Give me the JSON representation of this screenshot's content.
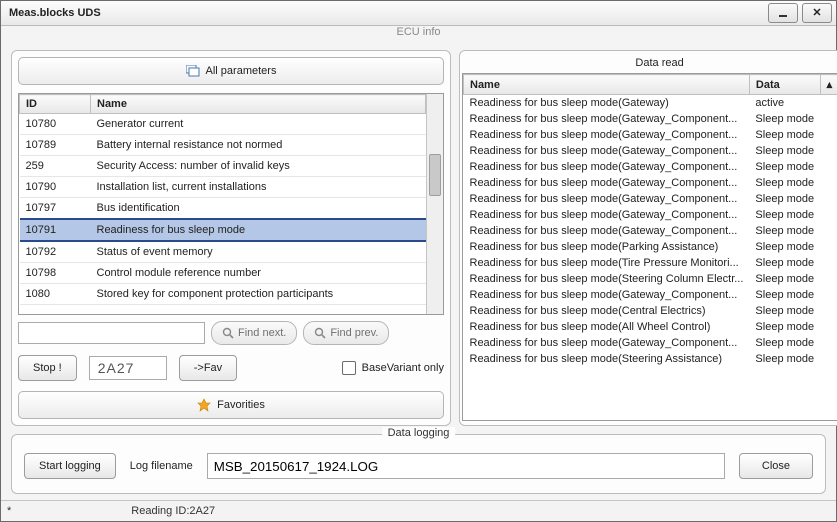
{
  "window": {
    "title": "Meas.blocks UDS",
    "subtitle": "ECU info"
  },
  "left": {
    "all_params_label": "All parameters",
    "columns": [
      "ID",
      "Name"
    ],
    "rows": [
      {
        "id": "10780",
        "name": "Generator current"
      },
      {
        "id": "10789",
        "name": "Battery internal resistance not normed"
      },
      {
        "id": "259",
        "name": "Security Access: number of invalid keys"
      },
      {
        "id": "10790",
        "name": "Installation list, current installations"
      },
      {
        "id": "10797",
        "name": "Bus identification"
      },
      {
        "id": "10791",
        "name": "Readiness for bus sleep mode",
        "selected": true
      },
      {
        "id": "10792",
        "name": "Status of event memory"
      },
      {
        "id": "10798",
        "name": "Control module reference number"
      },
      {
        "id": "1080",
        "name": "Stored key for component protection participants"
      }
    ],
    "find_next": "Find next.",
    "find_prev": "Find prev.",
    "stop": "Stop !",
    "code": "2A27",
    "to_fav": "->Fav",
    "basevariant": "BaseVariant only",
    "favorites": "Favorities"
  },
  "right": {
    "title": "Data read",
    "columns": [
      "Name",
      "Data"
    ],
    "rows": [
      {
        "name": "Readiness for bus sleep mode(Gateway)",
        "data": "active"
      },
      {
        "name": "Readiness for bus sleep mode(Gateway_Component...",
        "data": "Sleep mode"
      },
      {
        "name": "Readiness for bus sleep mode(Gateway_Component...",
        "data": "Sleep mode"
      },
      {
        "name": "Readiness for bus sleep mode(Gateway_Component...",
        "data": "Sleep mode"
      },
      {
        "name": "Readiness for bus sleep mode(Gateway_Component...",
        "data": "Sleep mode"
      },
      {
        "name": "Readiness for bus sleep mode(Gateway_Component...",
        "data": "Sleep mode"
      },
      {
        "name": "Readiness for bus sleep mode(Gateway_Component...",
        "data": "Sleep mode"
      },
      {
        "name": "Readiness for bus sleep mode(Gateway_Component...",
        "data": "Sleep mode"
      },
      {
        "name": "Readiness for bus sleep mode(Gateway_Component...",
        "data": "Sleep mode"
      },
      {
        "name": "Readiness for bus sleep mode(Parking Assistance)",
        "data": "Sleep mode"
      },
      {
        "name": "Readiness for bus sleep mode(Tire Pressure Monitori...",
        "data": "Sleep mode"
      },
      {
        "name": "Readiness for bus sleep mode(Steering Column Electr...",
        "data": "Sleep mode"
      },
      {
        "name": "Readiness for bus sleep mode(Gateway_Component...",
        "data": "Sleep mode"
      },
      {
        "name": "Readiness for bus sleep mode(Central Electrics)",
        "data": "Sleep mode"
      },
      {
        "name": "Readiness for bus sleep mode(All Wheel Control)",
        "data": "Sleep mode"
      },
      {
        "name": "Readiness for bus sleep mode(Gateway_Component...",
        "data": "Sleep mode"
      },
      {
        "name": "Readiness for bus sleep mode(Steering Assistance)",
        "data": "Sleep mode"
      }
    ]
  },
  "logging": {
    "title": "Data logging",
    "start": "Start logging",
    "filename_label": "Log filename",
    "filename": "MSB_20150617_1924.LOG",
    "close": "Close"
  },
  "status": {
    "indicator": "*",
    "text": "Reading ID:2A27"
  }
}
